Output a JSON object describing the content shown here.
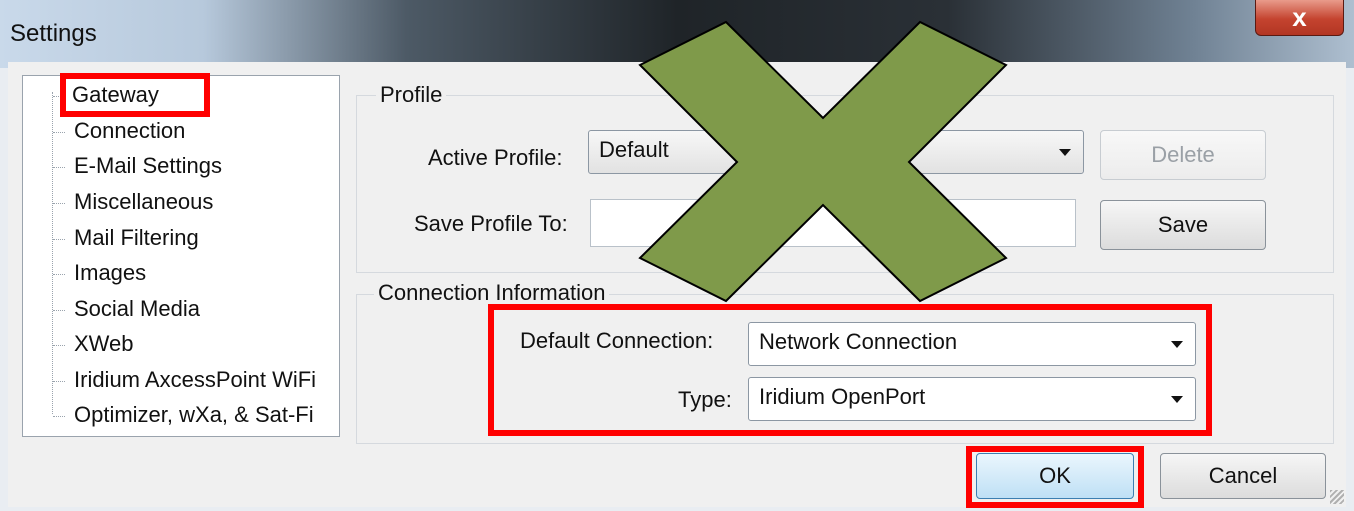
{
  "window": {
    "title": "Settings",
    "close_glyph": "x"
  },
  "tree": {
    "items": [
      {
        "label": "Gateway"
      },
      {
        "label": "Connection"
      },
      {
        "label": "E-Mail Settings"
      },
      {
        "label": "Miscellaneous"
      },
      {
        "label": "Mail Filtering"
      },
      {
        "label": "Images"
      },
      {
        "label": "Social Media"
      },
      {
        "label": "XWeb"
      },
      {
        "label": "Iridium AxcessPoint WiFi"
      },
      {
        "label": "Optimizer, wXa, & Sat-Fi"
      }
    ]
  },
  "profile": {
    "group_title": "Profile",
    "active_profile_label": "Active Profile:",
    "active_profile_value": "Default",
    "delete_label": "Delete",
    "save_profile_to_label": "Save Profile To:",
    "save_profile_to_value": "",
    "save_label": "Save"
  },
  "connection": {
    "group_title": "Connection Information",
    "default_connection_label": "Default Connection:",
    "default_connection_value": "Network Connection",
    "type_label": "Type:",
    "type_value": "Iridium OpenPort"
  },
  "footer": {
    "ok_label": "OK",
    "cancel_label": "Cancel"
  },
  "colors": {
    "highlight": "#ff0000",
    "cross": "#7f9a4a",
    "cross_outline": "#000000"
  }
}
